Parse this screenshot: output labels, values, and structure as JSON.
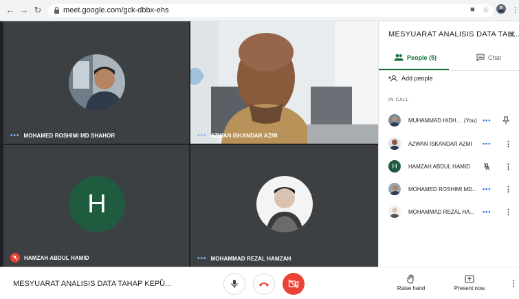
{
  "browser": {
    "url": "meet.google.com/gck-dbbx-ehs"
  },
  "tiles": [
    {
      "name": "MOHAMED ROSHIMI MD SHAHOR",
      "status": "dots"
    },
    {
      "name": "AZWAN ISKANDAR AZMI",
      "status": "dots"
    },
    {
      "name": "HAMZAH ABDUL HAMID",
      "status": "muted",
      "initial": "H"
    },
    {
      "name": "MOHAMMAD REZAL HAMZAH",
      "status": "dots"
    }
  ],
  "panel": {
    "title": "MESYUARAT ANALISIS DATA TAH...",
    "tab_people": "People (5)",
    "tab_chat": "Chat",
    "add_people": "Add people",
    "in_call_label": "IN CALL",
    "people": [
      {
        "name": "MUHAMMAD HIDH...",
        "suffix": "(You)",
        "action": "pin-icon"
      },
      {
        "name": "AZWAN ISKANDAR AZMI",
        "action": "more-vert-icon"
      },
      {
        "name": "HAMZAH ABDUL HAMID",
        "initial": "H",
        "action": "more-vert-icon",
        "muted": true
      },
      {
        "name": "MOHAMED ROSHIMI MD...",
        "action": "more-vert-icon"
      },
      {
        "name": "MOHAMMAD REZAL HA...",
        "action": "more-vert-icon"
      }
    ]
  },
  "bottom": {
    "meeting_title": "MESYUARAT ANALISIS DATA TAHAP KEPU...",
    "raise_hand": "Raise hand",
    "present_now": "Present now"
  },
  "colors": {
    "accent_green": "#137333",
    "danger_red": "#ea4335",
    "avatar_green": "#1e5b3f",
    "tile_bg": "#3c4043"
  }
}
